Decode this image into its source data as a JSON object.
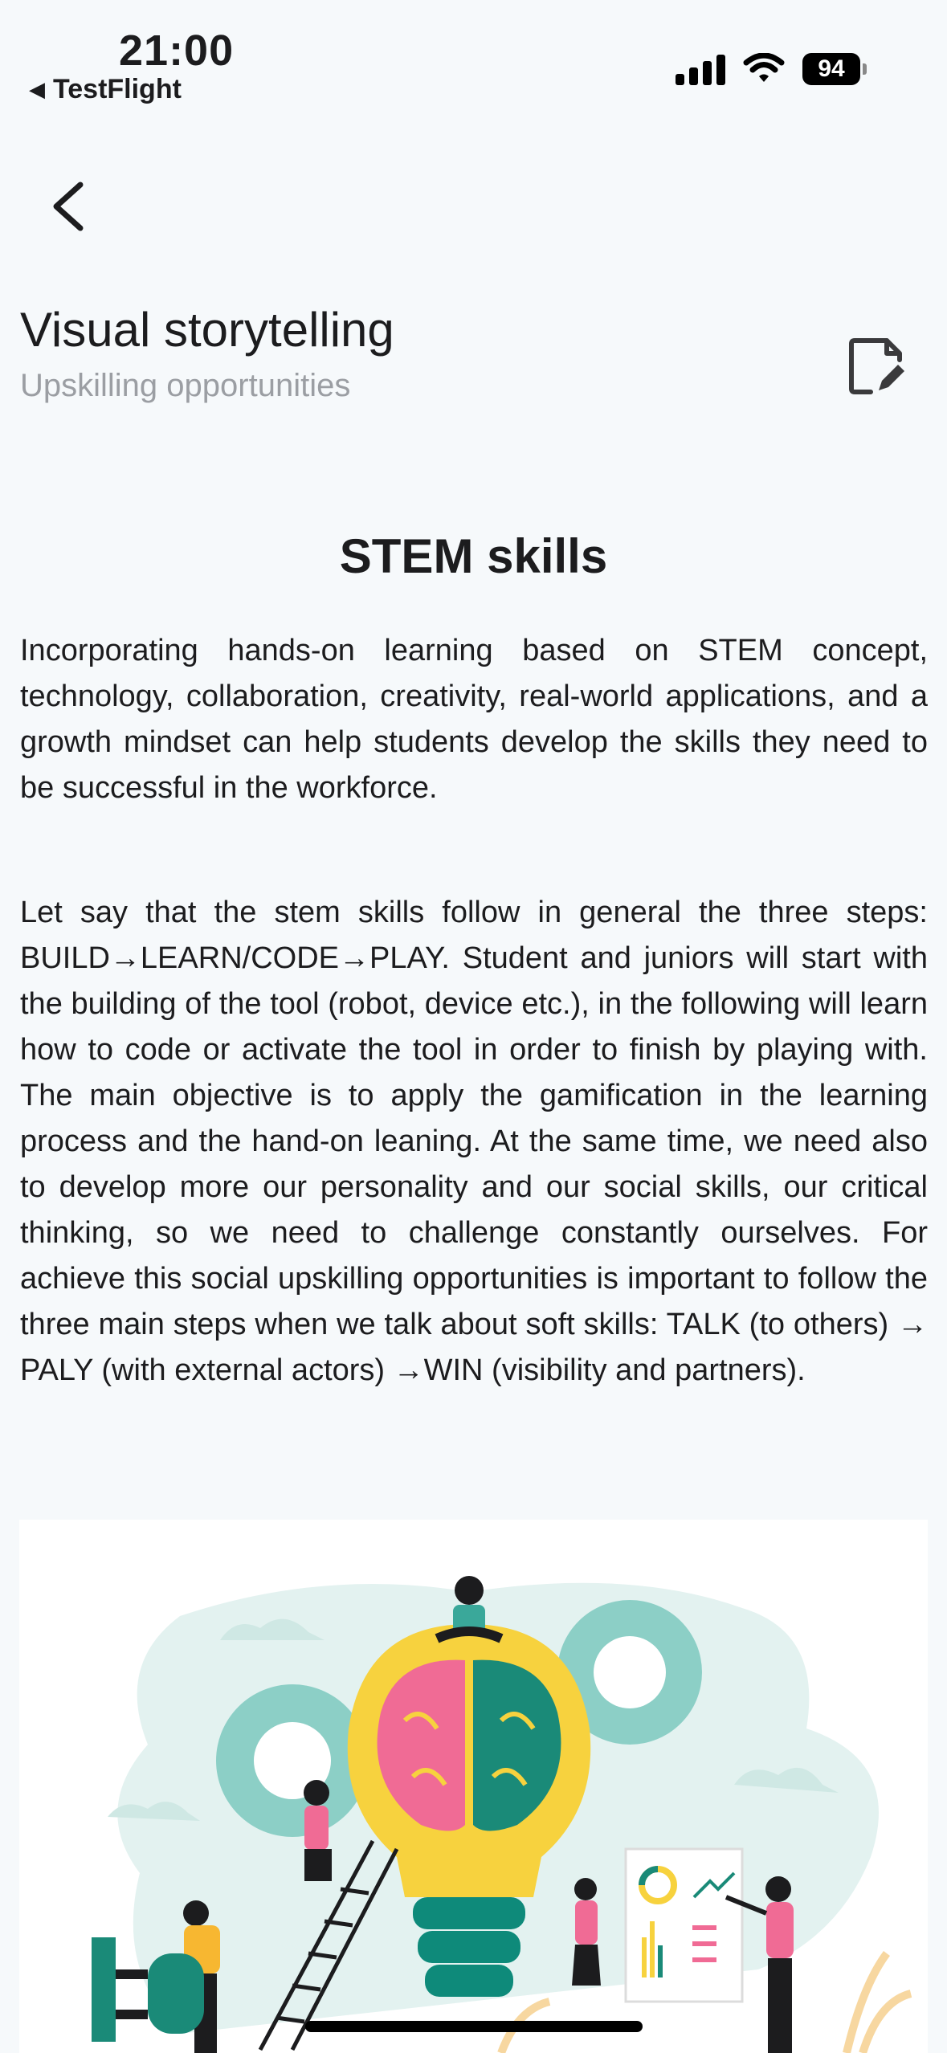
{
  "status_bar": {
    "time": "21:00",
    "back_app_label": "TestFlight",
    "battery_level": "94"
  },
  "header": {
    "title": "Visual storytelling",
    "subtitle": "Upskilling opportunities"
  },
  "content": {
    "section_title": "STEM skills",
    "paragraphs": [
      "Incorporating hands-on learning based on STEM concept, technology, collaboration, creativity, real-world applications, and a growth mindset can help students develop the skills they need to be successful in the workforce.",
      "Let say that the stem skills follow in general the three steps: BUILD→LEARN/CODE→PLAY. Student and juniors will start with the building of the tool (robot, device etc.), in the following will learn how to code or activate the tool in order to finish by playing with. The main objective is to apply the gamification in the learning process and the hand-on leaning. At the same time, we need also to develop more our personality and our social skills, our critical thinking, so we need to challenge constantly ourselves. For achieve this social upskilling opportunities is important to follow the three main steps when we talk about soft skills: TALK (to others) → PALY (with external actors) →WIN (visibility and partners)."
    ]
  },
  "icons": {
    "back": "chevron-left-icon",
    "edit": "edit-document-icon",
    "signal": "cellular-signal-icon",
    "wifi": "wifi-icon",
    "battery": "battery-icon"
  },
  "colors": {
    "background": "#f6f9fb",
    "subtitle": "#9b9ea3",
    "teal": "#8ccfc6",
    "brain_pink": "#f06b95",
    "brain_green": "#1a8a78",
    "bulb_yellow": "#f7d23e"
  }
}
